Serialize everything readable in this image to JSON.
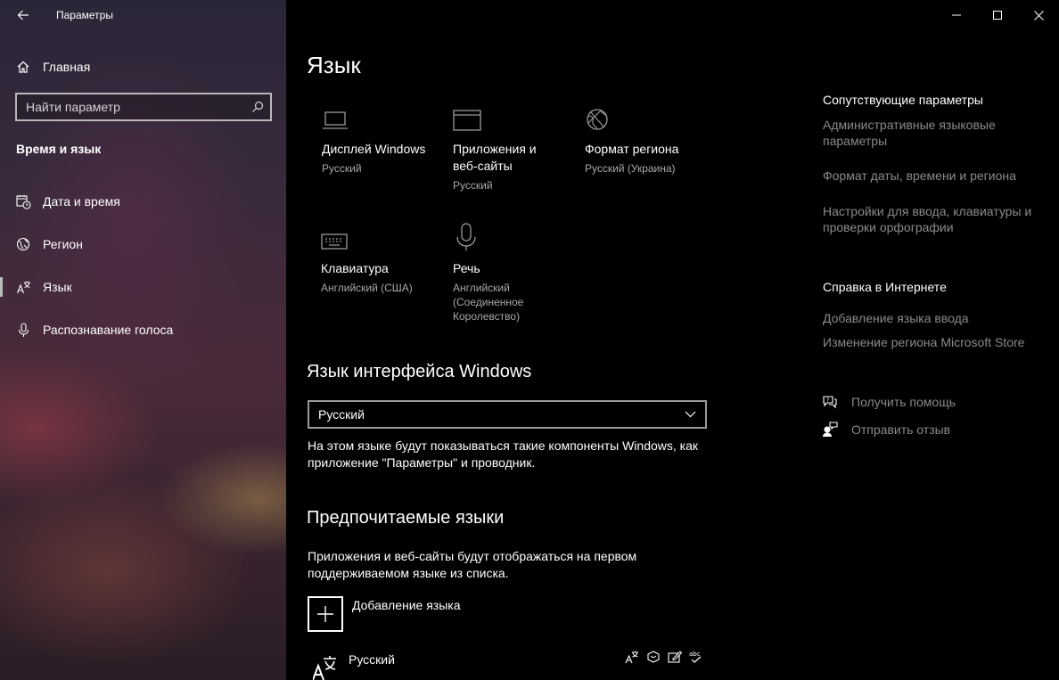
{
  "app": {
    "title": "Параметры"
  },
  "sidebar": {
    "home_label": "Главная",
    "search_placeholder": "Найти параметр",
    "section_title": "Время и язык",
    "items": [
      {
        "label": "Дата и время",
        "icon": "calendar-clock-icon",
        "selected": false
      },
      {
        "label": "Регион",
        "icon": "region-globe-icon",
        "selected": false
      },
      {
        "label": "Язык",
        "icon": "language-icon",
        "selected": true
      },
      {
        "label": "Распознавание голоса",
        "icon": "microphone-icon",
        "selected": false
      }
    ]
  },
  "main": {
    "page_title": "Язык",
    "tiles": [
      {
        "name": "Дисплей Windows",
        "value": "Русский",
        "icon": "monitor-icon"
      },
      {
        "name": "Приложения и веб-сайты",
        "value": "Русский",
        "icon": "browser-window-icon"
      },
      {
        "name": "Формат региона",
        "value": "Русский (Украина)",
        "icon": "region-format-icon"
      },
      {
        "name": "Клавиатура",
        "value": "Английский (США)",
        "icon": "keyboard-icon"
      },
      {
        "name": "Речь",
        "value": "Английский (Соединенное Королевство)",
        "icon": "microphone-icon"
      }
    ],
    "display_language": {
      "heading": "Язык интерфейса Windows",
      "selected": "Русский",
      "description": "На этом языке будут показываться такие компоненты Windows, как приложение \"Параметры\" и проводник."
    },
    "preferred": {
      "heading": "Предпочитаемые языки",
      "description": "Приложения и веб-сайты будут отображаться на первом поддерживаемом языке из списка.",
      "add_label": "Добавление языка",
      "languages": [
        {
          "name": "Русский",
          "features": [
            "display-language-icon",
            "speech-icon",
            "handwriting-icon",
            "spelling-icon"
          ]
        }
      ]
    }
  },
  "related": {
    "title": "Сопутствующие параметры",
    "links": [
      "Административные языковые параметры",
      "Формат даты, времени и региона",
      "Настройки для ввода, клавиатуры и проверки орфографии"
    ]
  },
  "help": {
    "title": "Справка в Интернете",
    "links": [
      "Добавление языка ввода",
      "Изменение региона Microsoft Store"
    ]
  },
  "actions": {
    "get_help": "Получить помощь",
    "feedback": "Отправить отзыв"
  },
  "colors": {
    "background": "#000000",
    "link_gray": "#8a8a8a",
    "secondary_text": "#a8a8a8",
    "selection_bar": "#bcbcbc"
  }
}
